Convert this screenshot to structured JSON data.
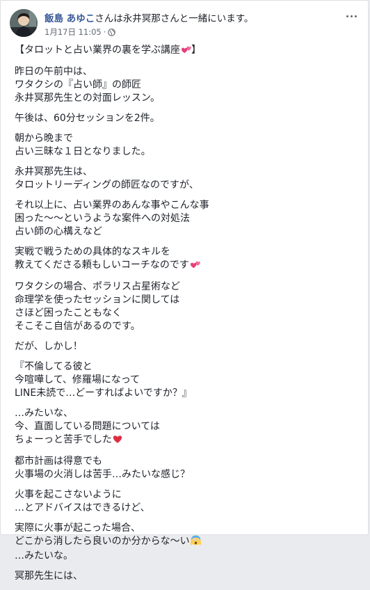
{
  "post": {
    "author": "飯島 あゆこ",
    "with_text": "さんは永井冥那さんと一緒にいます。",
    "date": "1月17日 11:05",
    "dot": "·",
    "paragraphs": [
      [
        "【タロットと占い業界の裏を学ぶ講座"
      ],
      [
        "昨日の午前中は、",
        "ワタクシの『占い師』の師匠",
        "永井冥那先生との対面レッスン。"
      ],
      [
        "午後は、60分セッションを2件。"
      ],
      [
        "朝から晩まで",
        "占い三昧な１日となりました。"
      ],
      [
        "永井冥那先生は、",
        "タロットリーディングの師匠なのですが、"
      ],
      [
        "それ以上に、占い業界のあんな事やこんな事",
        "困った〜〜というような案件への対処法",
        "占い師の心構えなど"
      ],
      [
        "実戦で戦うための具体的なスキルを",
        "教えてくださる頼もしいコーチなのです"
      ],
      [
        "ワタクシの場合、ポラリス占星術など",
        "命理学を使ったセッションに関しては",
        "さほど困ったこともなく",
        "そこそこ自信があるのです。"
      ],
      [
        "だが、しかし！"
      ],
      [
        "『不倫してる彼と",
        "今喧嘩して、修羅場になって",
        "LINE未読で…どーすればよいですか？』"
      ],
      [
        "…みたいな、",
        "今、直面している問題については",
        "ちょーっと苦手でした"
      ],
      [
        "都市計画は得意でも",
        "火事場の火消しは苦手…みたいな感じ？"
      ],
      [
        "火事を起こさないように",
        "…とアドバイスはできるけど、"
      ],
      [
        "実際に火事が起こった場合、",
        "どこから消したら良いのか分からな〜い",
        "…みたいな。"
      ],
      [
        "冥那先生には、"
      ]
    ],
    "title_suffix": "】",
    "emoji": {
      "p0": "two-hearts",
      "p6": "two-hearts",
      "p10": "red-heart",
      "p13": "screaming-face"
    }
  }
}
